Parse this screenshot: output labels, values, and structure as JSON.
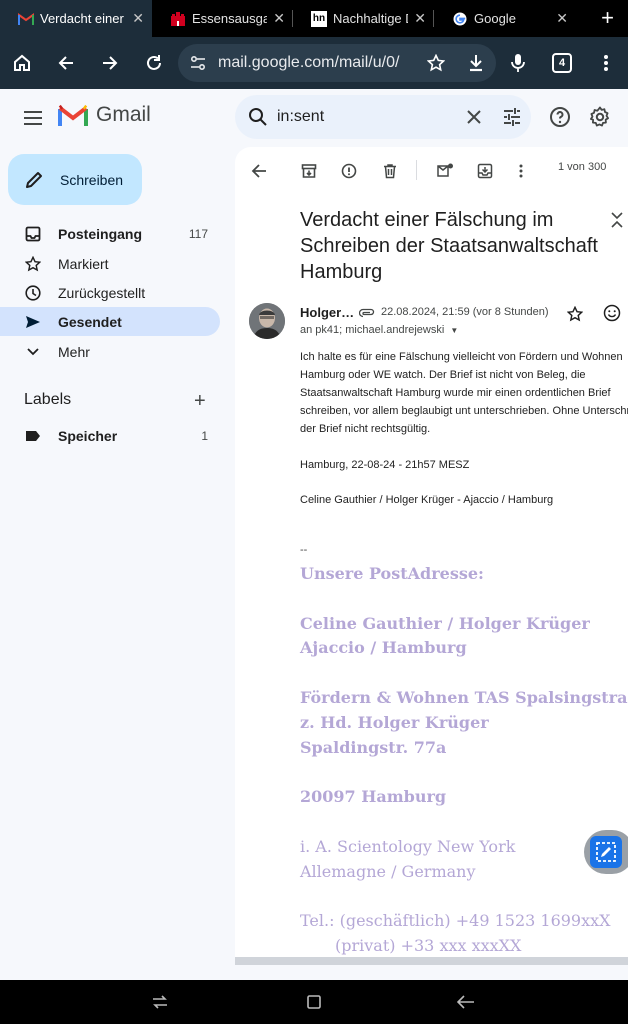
{
  "browser": {
    "tabs": [
      {
        "title": "Verdacht einer Fälschung",
        "favicon": "gmail-icon",
        "active": true
      },
      {
        "title": "Essensausgabe",
        "favicon": "hamburg-icon",
        "active": false
      },
      {
        "title": "Nachhaltige Da",
        "favicon": "hn-icon",
        "favicon_text": "hn",
        "active": false
      },
      {
        "title": "Google",
        "favicon": "google-icon",
        "active": false
      }
    ],
    "url": "mail.google.com/mail/u/0/",
    "tab_count": "4",
    "colors": {
      "tab_bar": "#000000",
      "toolbar": "#1d2d3a",
      "omnibox": "#2c3e4d"
    }
  },
  "gmail": {
    "logo_text": "Gmail",
    "search_value": "in:sent",
    "compose_label": "Schreiben",
    "nav": [
      {
        "label": "Posteingang",
        "icon": "inbox-icon",
        "count": "117",
        "bold": true
      },
      {
        "label": "Markiert",
        "icon": "star-icon",
        "count": ""
      },
      {
        "label": "Zurückgestellt",
        "icon": "clock-icon",
        "count": ""
      },
      {
        "label": "Gesendet",
        "icon": "send-icon",
        "count": "",
        "bold": true,
        "active": true
      },
      {
        "label": "Mehr",
        "icon": "chevron-down-icon",
        "count": ""
      }
    ],
    "labels_title": "Labels",
    "labels": [
      {
        "label": "Speicher",
        "icon": "label-icon",
        "count": "1"
      }
    ]
  },
  "message": {
    "pager": "1 von 300",
    "subject": "Verdacht einer Fälschung im Schreiben der Staatsanwaltschaft Hamburg",
    "sender": "Holger…",
    "date": "22.08.2024, 21:59 (vor 8 Stunden)",
    "recipients": "an pk41; michael.andrejewski",
    "body_lines": [
      "Ich halte es für eine Fälschung vielleicht von Fördern und Wohnen",
      "Hamburg oder WE watch. Der Brief ist nicht von Beleg, die",
      "Staatsanwaltschaft Hamburg wurde mir einen ordentlichen Brief",
      "schreiben, vor allem beglaubigt unt unterschrieben. Ohne Unterschrift",
      "der Brief nicht rechtsgültig."
    ],
    "timestamp_line": "Hamburg, 22-08-24 - 21h57 MESZ",
    "names_line": "Celine Gauthier / Holger Krüger - Ajaccio / Hamburg",
    "sig_separator": "--",
    "signature": {
      "heading": "Unsere PostAdresse:",
      "names": "Celine Gauthier / Holger Krüger",
      "cities": "Ajaccio / Hamburg",
      "org": "Fördern & Wohnen TAS Spalsingstraße",
      "attn": "z. Hd. Holger Krüger",
      "street": "Spaldingstr. 77a",
      "zip_city": "20097 Hamburg",
      "proxy": "i. A. Scientology New York",
      "country": "Allemagne / Germany",
      "tel_business": "Tel.: (geschäftlich) +49 1523 1699xxX",
      "tel_private": "(privat) +33 xxx xxxXX"
    },
    "signature_color": "#b4a7d6"
  }
}
